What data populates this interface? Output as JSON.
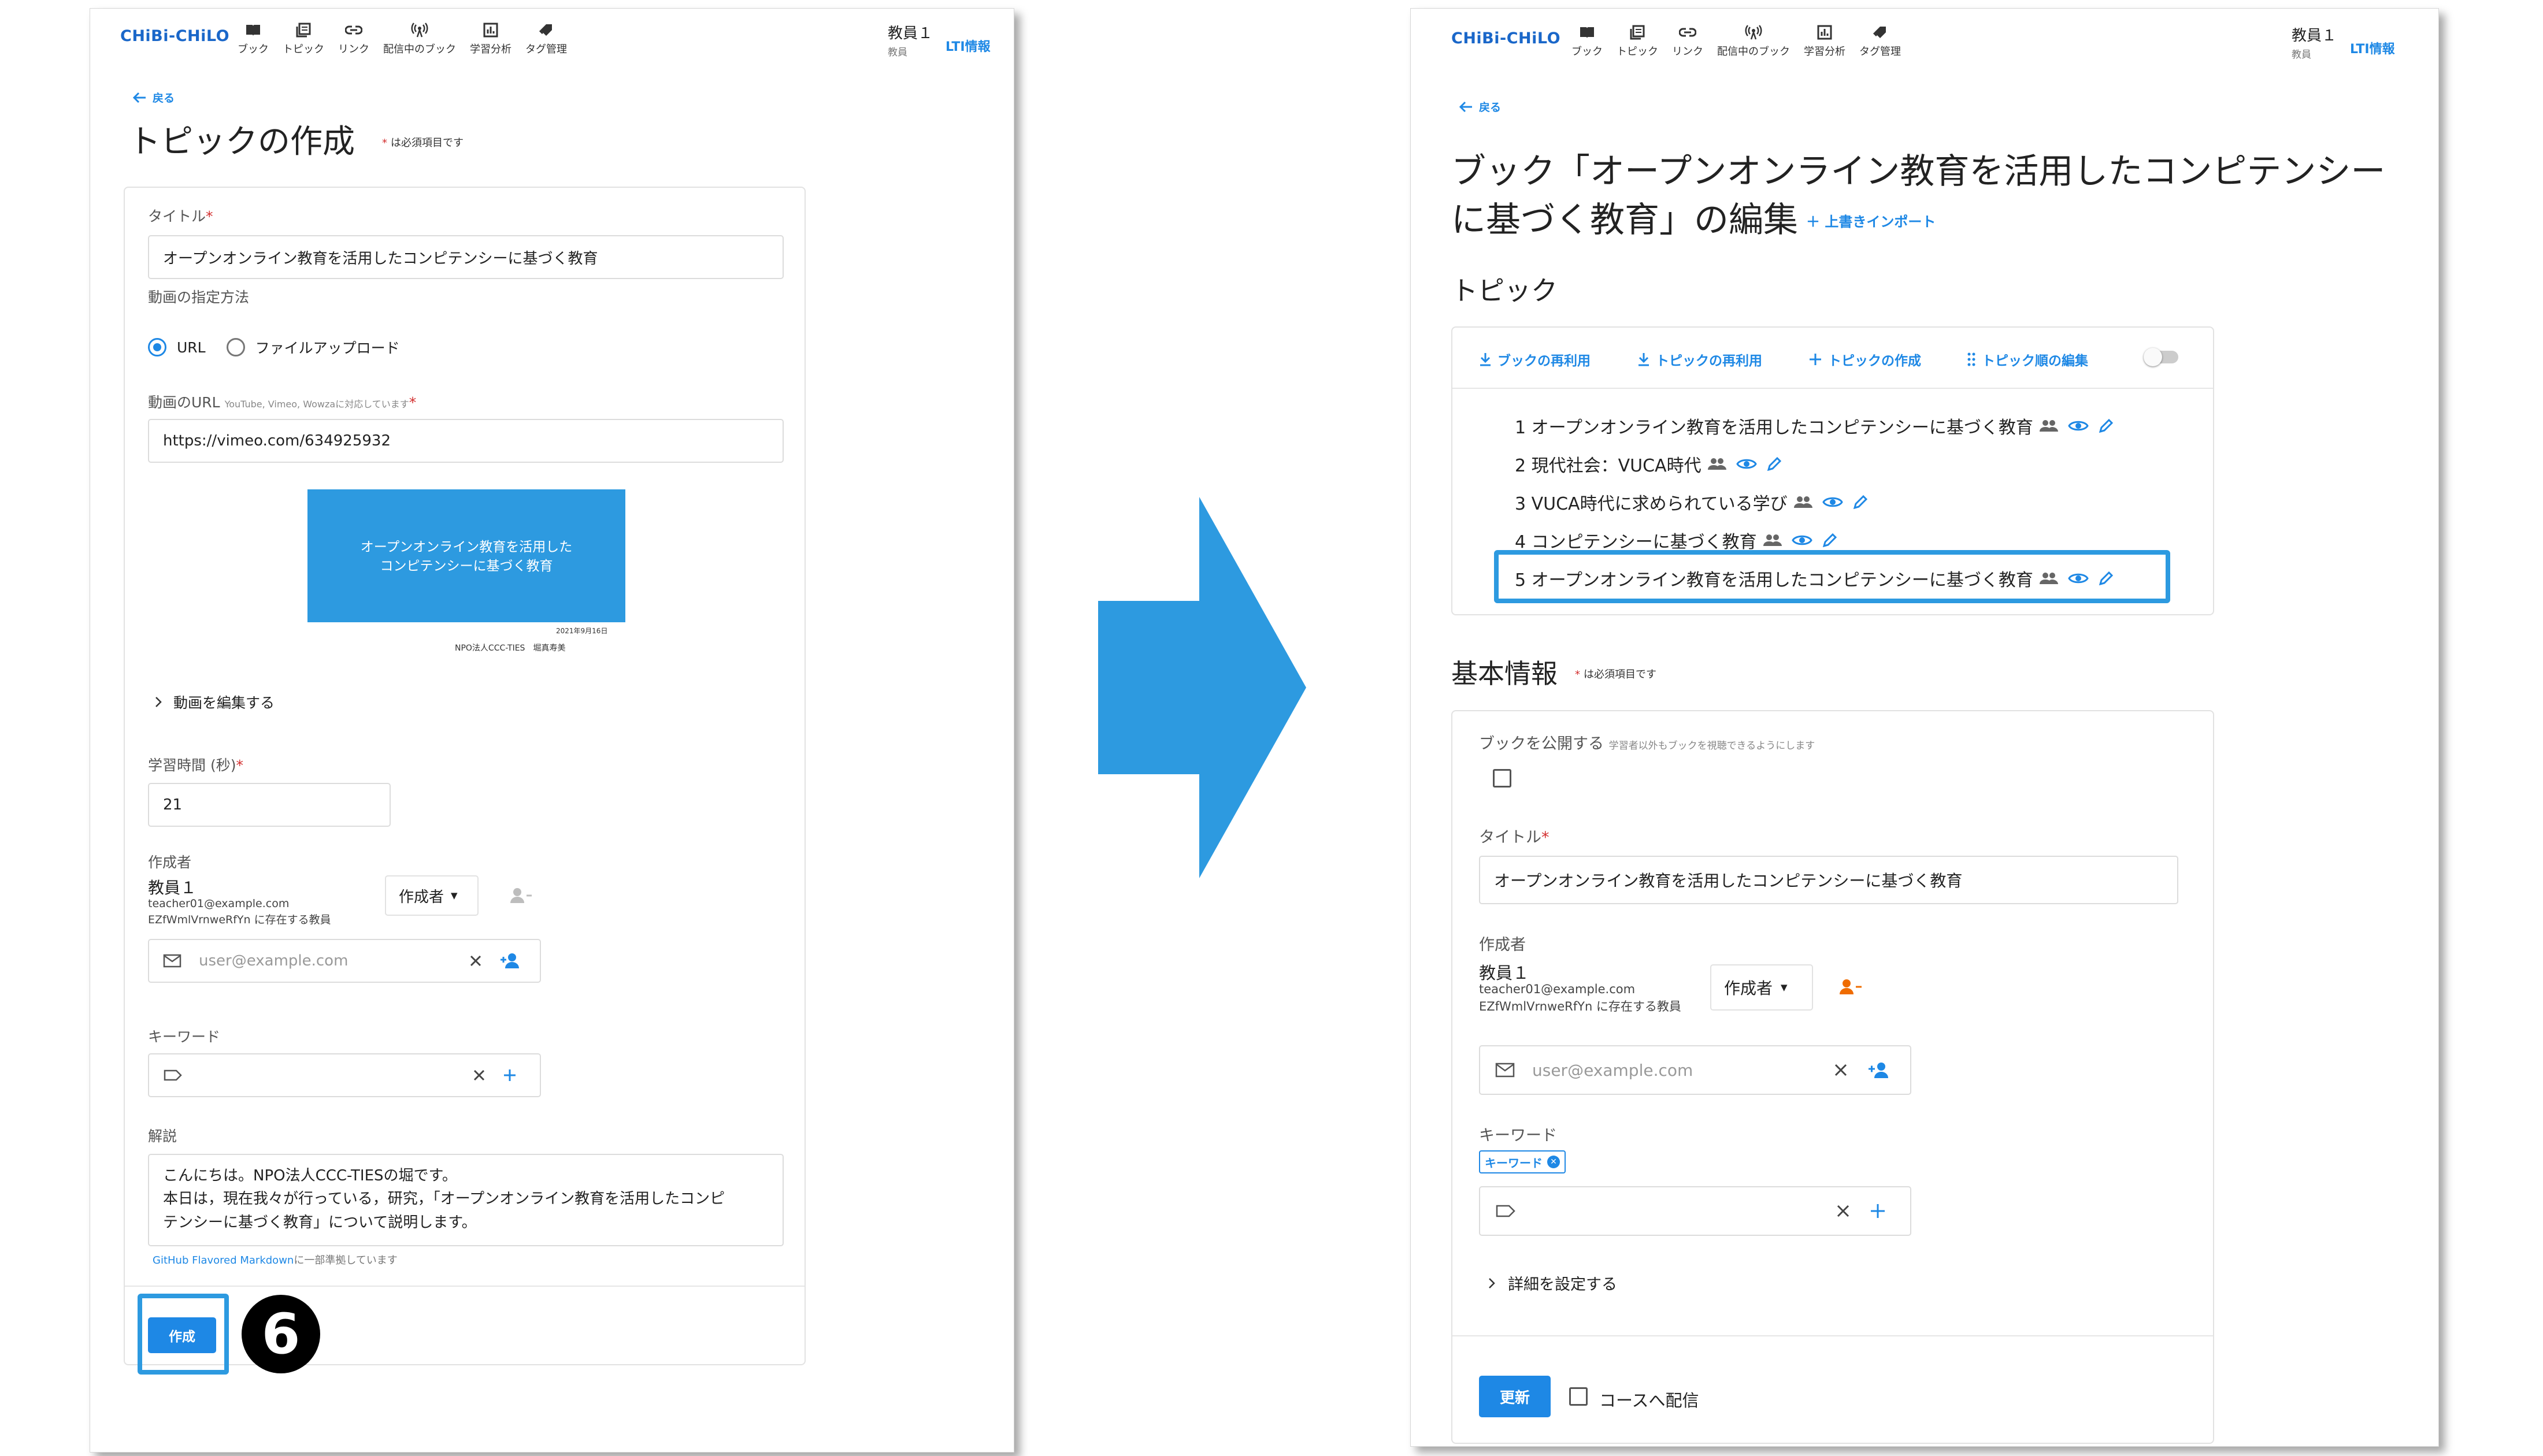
{
  "app": {
    "logo": "CHiBi-CHiLO",
    "nav": [
      {
        "label": "ブック",
        "icon": "book-icon"
      },
      {
        "label": "トピック",
        "icon": "topic-icon"
      },
      {
        "label": "リンク",
        "icon": "link-icon"
      },
      {
        "label": "配信中のブック",
        "icon": "broadcast-icon"
      },
      {
        "label": "学習分析",
        "icon": "analytics-icon"
      },
      {
        "label": "タグ管理",
        "icon": "tag-icon"
      }
    ],
    "user_name": "教員１",
    "user_role": "教員",
    "lti_label": "LTI情報",
    "back_label": "戻る",
    "required_note": "は必須項目です",
    "accent_color": "#1e88e5"
  },
  "left": {
    "title": "トピックの作成",
    "title_label": "タイトル",
    "title_value": "オープンオンライン教育を活用したコンピテンシーに基づく教育",
    "video_method_label": "動画の指定方法",
    "radio_url": "URL",
    "radio_upload": "ファイルアップロード",
    "video_url_label": "動画のURL",
    "video_url_note": "YouTube, Vimeo, Wowzaに対応しています",
    "video_url_value": "https://vimeo.com/634925932",
    "thumb_line1": "オープンオンライン教育を活用した",
    "thumb_line2": "コンピテンシーに基づく教育",
    "thumb_date": "2021年9月16日",
    "thumb_author": "NPO法人CCC-TIES　堀真寿美",
    "edit_video": "動画を編集する",
    "duration_label": "学習時間 (秒)",
    "duration_value": "21",
    "author_label": "作成者",
    "author_name": "教員１",
    "author_email": "teacher01@example.com",
    "author_org": "EZfWmlVrnweRfYn に存在する教員",
    "author_role": "作成者",
    "email_placeholder": "user@example.com",
    "keyword_label": "キーワード",
    "desc_label": "解説",
    "desc_line1": "こんにちは。NPO法人CCC-TIESの堀です。",
    "desc_line2": "本日は，現在我々が行っている，研究，｢オープンオンライン教育を活用したコンピ",
    "desc_line3": "テンシーに基づく教育」について説明します。",
    "md_link": "GitHub Flavored Markdown",
    "md_note": "に一部準拠しています",
    "create_button": "作成",
    "step_number": "6"
  },
  "right": {
    "title": "ブック「オープンオンライン教育を活用したコンピテンシーに基づく教育」の編集",
    "overwrite_import": "上書きインポート",
    "topics_heading": "トピック",
    "toolbar": [
      "ブックの再利用",
      "トピックの再利用",
      "トピックの作成",
      "トピック順の編集"
    ],
    "topics": [
      "1 オープンオンライン教育を活用したコンピテンシーに基づく教育",
      "2 現代社会：VUCA時代",
      "3 VUCA時代に求められている学び",
      "4 コンピテンシーに基づく教育",
      "5 オープンオンライン教育を活用したコンピテンシーに基づく教育"
    ],
    "info_heading": "基本情報",
    "publish_label": "ブックを公開する",
    "publish_note": "学習者以外もブックを視聴できるようにします",
    "title_label": "タイトル",
    "title_value": "オープンオンライン教育を活用したコンピテンシーに基づく教育",
    "author_label": "作成者",
    "author_name": "教員１",
    "author_email": "teacher01@example.com",
    "author_org": "EZfWmlVrnweRfYn に存在する教員",
    "author_role": "作成者",
    "email_placeholder": "user@example.com",
    "keyword_label": "キーワード",
    "keyword_chip": "キーワード",
    "details": "詳細を設定する",
    "update_button": "更新",
    "course_checkbox": "コースへ配信"
  }
}
